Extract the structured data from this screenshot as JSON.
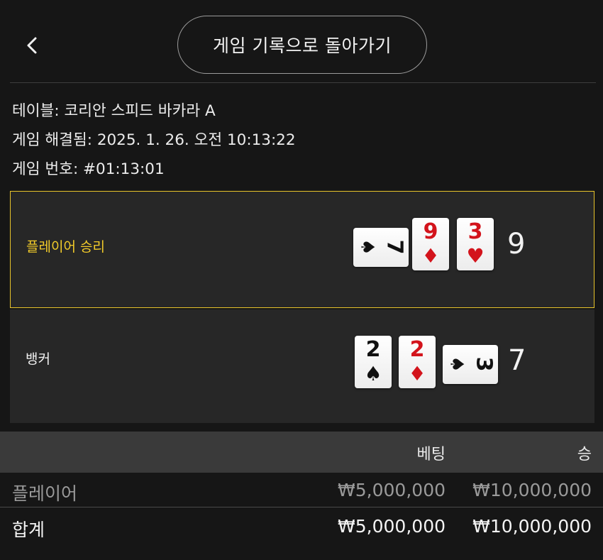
{
  "header": {
    "back_icon": "chevron-left-icon",
    "return_label": "게임 기록으로 돌아가기"
  },
  "info": {
    "table_label": "테이블:",
    "table_value": "코리안 스피드 바카라 A",
    "resolved_label": "게임 해결됨:",
    "resolved_value": "2025. 1. 26. 오전 10:13:22",
    "number_label": "게임 번호:",
    "number_value": "#01:13:01"
  },
  "player": {
    "label": "플레이어 승리",
    "total": "9",
    "cards": [
      {
        "rank": "7",
        "suit": "♠",
        "color": "black",
        "orientation": "sideways"
      },
      {
        "rank": "9",
        "suit": "♦",
        "color": "red",
        "orientation": "upright"
      },
      {
        "rank": "3",
        "suit": "♥",
        "color": "red",
        "orientation": "upright"
      }
    ]
  },
  "banker": {
    "label": "뱅커",
    "total": "7",
    "cards": [
      {
        "rank": "2",
        "suit": "♠",
        "color": "black",
        "orientation": "upright"
      },
      {
        "rank": "2",
        "suit": "♦",
        "color": "red",
        "orientation": "upright"
      },
      {
        "rank": "3",
        "suit": "♠",
        "color": "black",
        "orientation": "sideways"
      }
    ]
  },
  "bets_table": {
    "headers": {
      "bet": "베팅",
      "win": "승"
    },
    "rows": [
      {
        "name": "플레이어",
        "bet": "₩5,000,000",
        "win": "₩10,000,000"
      }
    ],
    "total": {
      "name": "합계",
      "bet": "₩5,000,000",
      "win": "₩10,000,000"
    }
  },
  "colors": {
    "accent_winner": "#f3cc2a",
    "card_red": "#d3141c",
    "background": "#161616"
  }
}
